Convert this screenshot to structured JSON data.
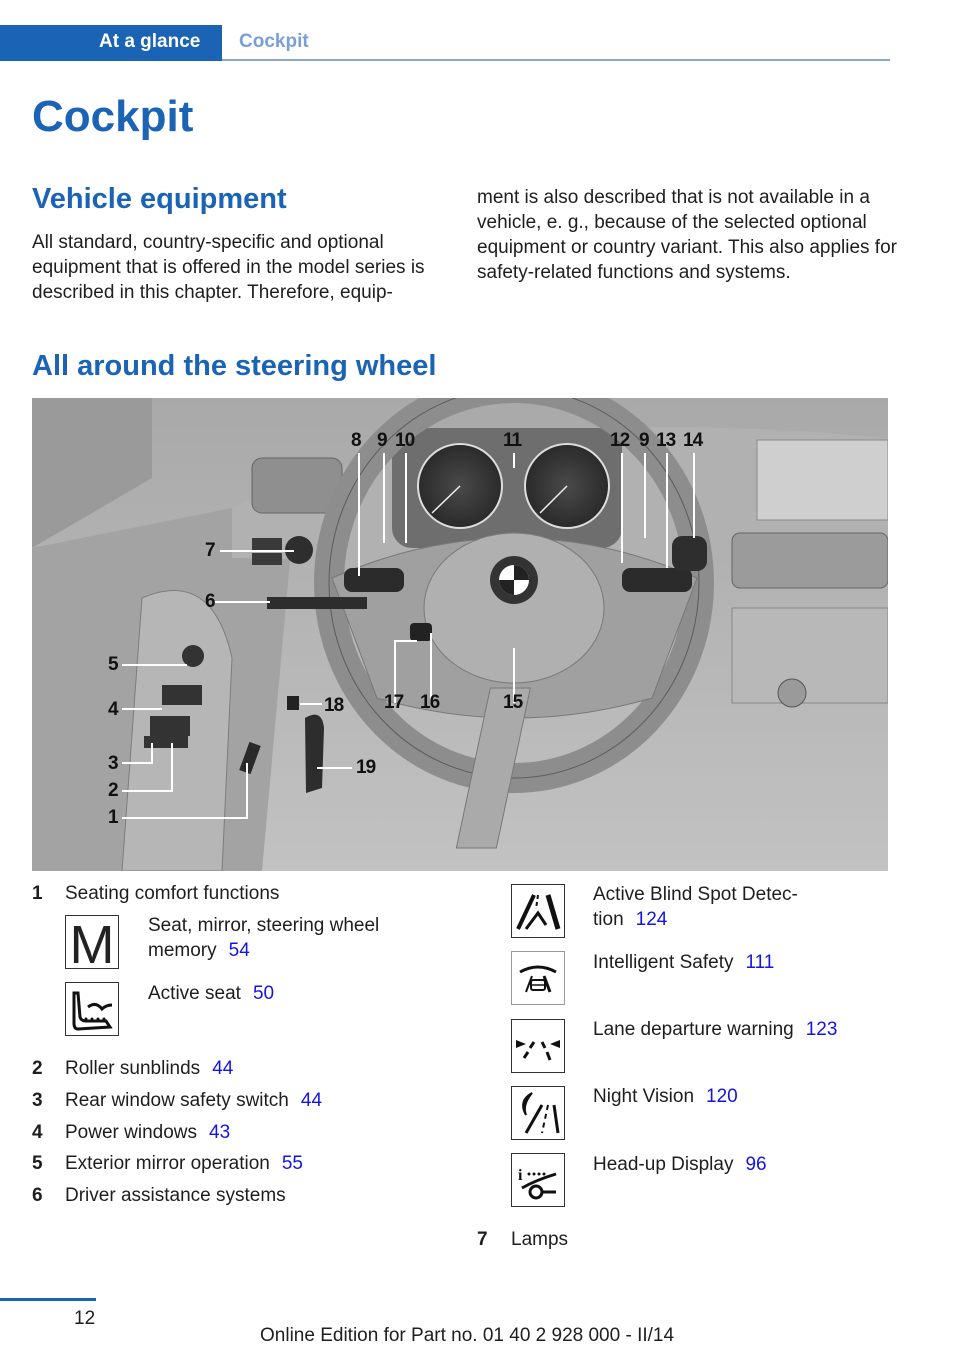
{
  "header": {
    "section": "At a glance",
    "chapter": "Cockpit"
  },
  "page_title": "Cockpit",
  "vehicle_equipment": {
    "heading": "Vehicle equipment",
    "paragraph_left": "All standard, country-specific and optional equipment that is offered in the model series is described in this chapter. Therefore, equip-",
    "paragraph_right": "ment is also described that is not available in a vehicle, e. g., because of the selected optional equipment or country variant. This also applies for safety-related functions and systems."
  },
  "steering_section": {
    "heading": "All around the steering wheel",
    "figure_callouts": [
      "1",
      "2",
      "3",
      "4",
      "5",
      "6",
      "7",
      "8",
      "9",
      "10",
      "11",
      "12",
      "9",
      "13",
      "14",
      "15",
      "16",
      "17",
      "18",
      "19"
    ]
  },
  "legend_left": [
    {
      "number": "1",
      "label": "Seating comfort functions",
      "sub_items": [
        {
          "icon": "memory-m-icon",
          "label_line1": "Seat, mirror, steering wheel",
          "label_line2": "memory",
          "page": "54"
        },
        {
          "icon": "active-seat-icon",
          "label_line1": "Active seat",
          "page": "50"
        }
      ]
    },
    {
      "number": "2",
      "label": "Roller sunblinds",
      "page": "44"
    },
    {
      "number": "3",
      "label": "Rear window safety switch",
      "page": "44"
    },
    {
      "number": "4",
      "label": "Power windows",
      "page": "43"
    },
    {
      "number": "5",
      "label": "Exterior mirror operation",
      "page": "55"
    },
    {
      "number": "6",
      "label": "Driver assistance systems"
    }
  ],
  "legend_right": {
    "sub_items": [
      {
        "icon": "blind-spot-icon",
        "label_line1": "Active Blind Spot Detec-",
        "label_line2": "tion",
        "page": "124"
      },
      {
        "icon": "intelligent-safety-icon",
        "label_line1": "Intelligent Safety",
        "page": "111"
      },
      {
        "icon": "lane-departure-icon",
        "label_line1": "Lane departure warning",
        "page": "123"
      },
      {
        "icon": "night-vision-icon",
        "label_line1": "Night Vision",
        "page": "120"
      },
      {
        "icon": "head-up-display-icon",
        "label_line1": "Head-up Display",
        "page": "96"
      }
    ],
    "item7": {
      "number": "7",
      "label": "Lamps"
    }
  },
  "footer": {
    "page_number": "12",
    "edition": "Online Edition for Part no. 01 40 2 928 000 - II/14"
  },
  "colors": {
    "brand_blue": "#1a63b5",
    "link_blue": "#1414e6",
    "tab_inactive": "#7a9fd8"
  }
}
